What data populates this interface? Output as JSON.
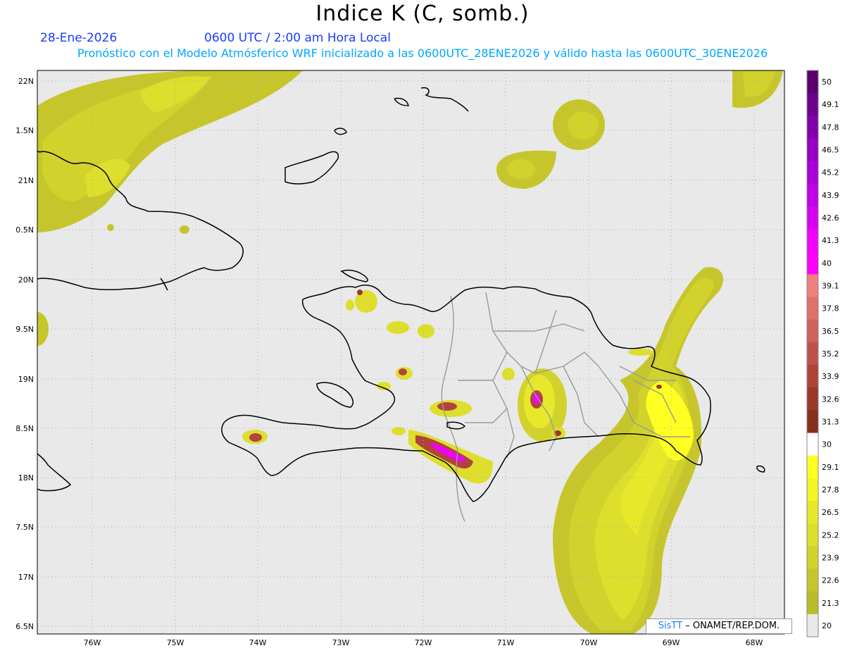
{
  "title": "Indice K (C, somb.)",
  "date": "28-Ene-2026",
  "time": "0600 UTC / 2:00 am Hora Local",
  "forecast": "Pronóstico con el Modelo Atmósferico WRF inicializado a las 0600UTC_28ENE2026 y válido hasta las  0600UTC_30ENE2026",
  "credit": {
    "brand": "SisTT",
    "org": "– ONAMET/REP.DOM."
  },
  "map": {
    "lat_labels": [
      "22N",
      "1.5N",
      "21N",
      "0.5N",
      "20N",
      "9.5N",
      "19N",
      "8.5N",
      "18N",
      "7.5N",
      "17N",
      "6.5N"
    ],
    "lon_labels": [
      "76W",
      "75W",
      "74W",
      "73W",
      "72W",
      "71W",
      "70W",
      "69W",
      "68W"
    ],
    "background_color": "#e9e9e9",
    "coast_color": "#000000",
    "border_color": "#9a9a9a"
  },
  "colorbar": {
    "labels": [
      "50",
      "49.1",
      "47.8",
      "46.5",
      "45.2",
      "43.9",
      "42.6",
      "41.3",
      "40",
      "39.1",
      "37.8",
      "36.5",
      "35.2",
      "33.9",
      "32.6",
      "31.3",
      "30",
      "29.1",
      "27.8",
      "26.5",
      "25.2",
      "23.9",
      "22.6",
      "21.3",
      "20"
    ],
    "colors": [
      "#5a006e",
      "#6e0090",
      "#8200aa",
      "#9600c0",
      "#aa00d8",
      "#c000e6",
      "#d800f0",
      "#f000ff",
      "#ff00ff",
      "#f08080",
      "#e07068",
      "#d0605a",
      "#c0504a",
      "#ae4438",
      "#9a382a",
      "#86301e",
      "#ffffff",
      "#ffff22",
      "#f4f426",
      "#e8e82a",
      "#dede2c",
      "#d2d22c",
      "#c6c62c",
      "#bbbb2a",
      "#e9e9e9"
    ]
  }
}
